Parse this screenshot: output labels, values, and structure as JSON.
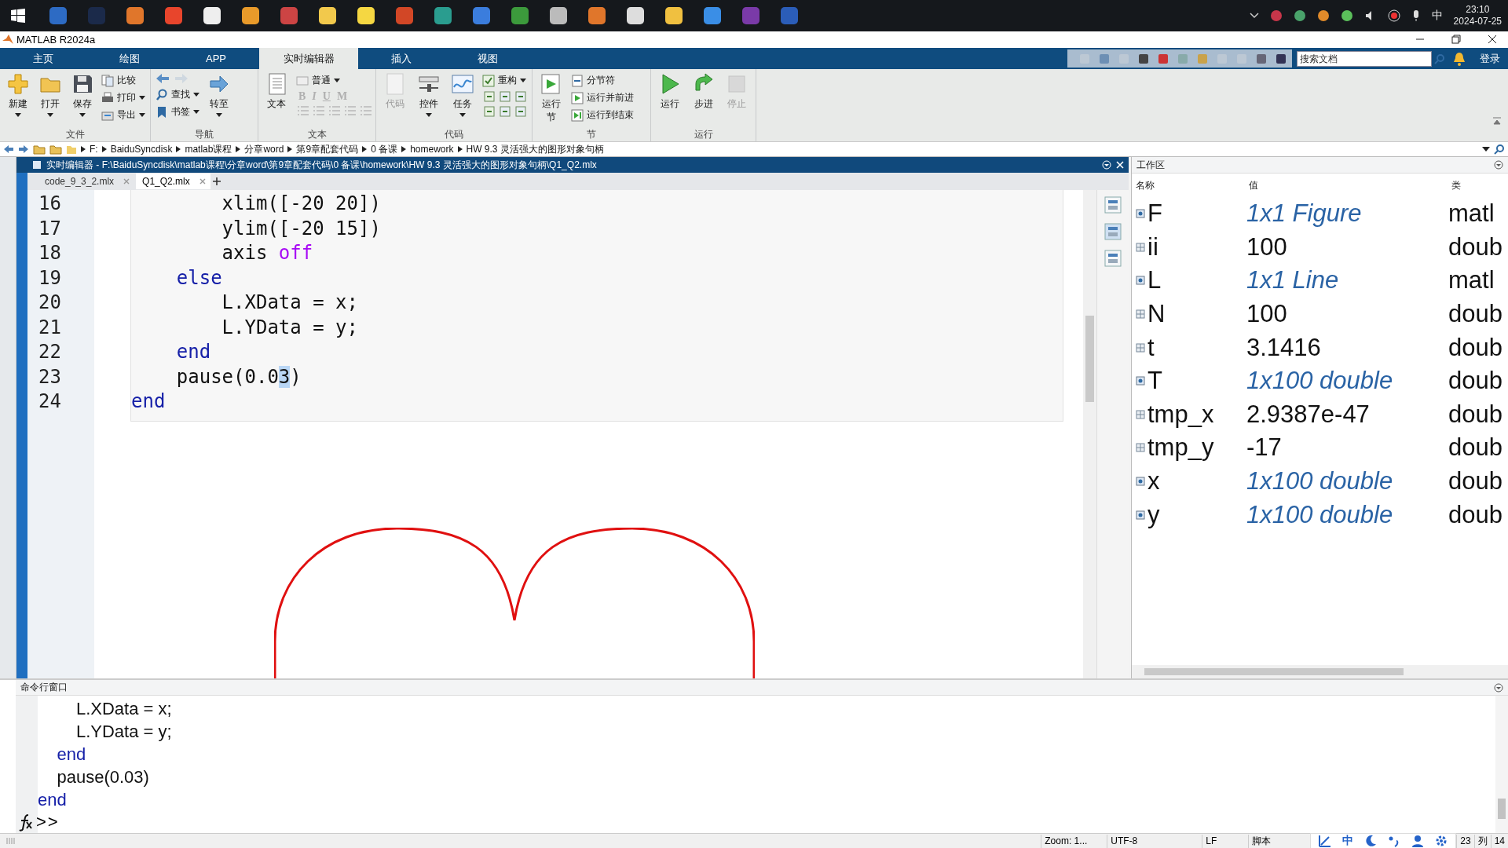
{
  "taskbar": {
    "time": "23:10",
    "date": "2024-07-25",
    "ime": "中"
  },
  "window": {
    "title": "MATLAB R2024a"
  },
  "ribbon_tabs": [
    {
      "label": "主页",
      "selected": false
    },
    {
      "label": "绘图",
      "selected": false
    },
    {
      "label": "APP",
      "selected": false
    },
    {
      "label": "实时编辑器",
      "selected": true
    },
    {
      "label": "插入",
      "selected": false
    },
    {
      "label": "视图",
      "selected": false
    }
  ],
  "search": {
    "placeholder": "搜索文档"
  },
  "sign_in": "登录",
  "ribbon": {
    "groups": [
      {
        "label": "文件",
        "large": [
          {
            "label": "新建",
            "dropdown": true,
            "disabled": false
          },
          {
            "label": "打开",
            "dropdown": true,
            "disabled": false
          },
          {
            "label": "保存",
            "dropdown": true,
            "disabled": false
          }
        ],
        "small": [
          {
            "label": "比较",
            "dropdown": false,
            "disabled": false
          },
          {
            "label": "打印",
            "dropdown": true,
            "disabled": false
          },
          {
            "label": "导出",
            "dropdown": true,
            "disabled": false
          }
        ]
      },
      {
        "label": "导航",
        "large": [
          {
            "label": "转至",
            "dropdown": true,
            "disabled": false
          }
        ],
        "small": [
          {
            "label": "查找",
            "dropdown": true,
            "disabled": false
          },
          {
            "label": "书签",
            "dropdown": true,
            "disabled": false
          }
        ]
      },
      {
        "label": "文本",
        "large": [
          {
            "label": "文本",
            "dropdown": false,
            "disabled": false
          }
        ],
        "small": [
          {
            "label": "普通",
            "dropdown": true,
            "disabled": false
          }
        ],
        "format": [
          {
            "label": "B",
            "disabled": true
          },
          {
            "label": "I",
            "disabled": true
          },
          {
            "label": "U",
            "disabled": true
          },
          {
            "label": "M",
            "disabled": true
          }
        ]
      },
      {
        "label": "代码",
        "large": [
          {
            "label": "代码",
            "dropdown": false,
            "disabled": true
          },
          {
            "label": "控件",
            "dropdown": true,
            "disabled": false
          },
          {
            "label": "任务",
            "dropdown": true,
            "disabled": false
          }
        ],
        "small": [
          {
            "label": "重构",
            "dropdown": true,
            "disabled": false
          }
        ]
      },
      {
        "label": "节",
        "large": [
          {
            "label": "运行节",
            "dropdown": false,
            "disabled": false
          }
        ],
        "small": [
          {
            "label": "分节符",
            "dropdown": false,
            "disabled": false
          },
          {
            "label": "运行并前进",
            "dropdown": false,
            "disabled": false
          },
          {
            "label": "运行到结束",
            "dropdown": false,
            "disabled": false
          }
        ]
      },
      {
        "label": "运行",
        "large": [
          {
            "label": "运行",
            "dropdown": false,
            "disabled": false
          },
          {
            "label": "步进",
            "dropdown": false,
            "disabled": false
          },
          {
            "label": "停止",
            "dropdown": false,
            "disabled": true
          }
        ]
      }
    ]
  },
  "address_path": [
    "F:",
    "BaiduSyncdisk",
    "matlab课程",
    "分章word",
    "第9章配套代码",
    "0 备课",
    "homework",
    "HW 9.3 灵活强大的图形对象句柄"
  ],
  "editor": {
    "title": "实时编辑器 - F:\\BaiduSyncdisk\\matlab课程\\分章word\\第9章配套代码\\0 备课\\homework\\HW 9.3 灵活强大的图形对象句柄\\Q1_Q2.mlx",
    "tabs": [
      {
        "label": "code_9_3_2.mlx",
        "selected": false
      },
      {
        "label": "Q1_Q2.mlx",
        "selected": true
      }
    ],
    "lines": [
      {
        "number": "16",
        "tokens": [
          {
            "text": "        xlim([-20 20])",
            "kind": "plain"
          }
        ]
      },
      {
        "number": "17",
        "tokens": [
          {
            "text": "        ylim([-20 15])",
            "kind": "plain"
          }
        ]
      },
      {
        "number": "18",
        "tokens": [
          {
            "text": "        axis ",
            "kind": "plain"
          },
          {
            "text": "off",
            "kind": "string"
          }
        ]
      },
      {
        "number": "19",
        "tokens": [
          {
            "text": "    else",
            "kind": "keyword"
          }
        ]
      },
      {
        "number": "20",
        "tokens": [
          {
            "text": "        L.XData = x;",
            "kind": "plain"
          }
        ]
      },
      {
        "number": "21",
        "tokens": [
          {
            "text": "        L.YData = y;",
            "kind": "plain"
          }
        ]
      },
      {
        "number": "22",
        "tokens": [
          {
            "text": "    end",
            "kind": "keyword"
          }
        ]
      },
      {
        "number": "23",
        "tokens": [
          {
            "text": "    pause(0.0",
            "kind": "plain"
          },
          {
            "text": "3",
            "kind": "selection"
          },
          {
            "text": ")",
            "kind": "plain"
          }
        ]
      },
      {
        "number": "24",
        "tokens": [
          {
            "text": "end",
            "kind": "keyword"
          }
        ]
      }
    ]
  },
  "workspace": {
    "title": "工作区",
    "columns": [
      "名称",
      "值",
      "类"
    ],
    "rows": [
      {
        "name": "F",
        "value": "1x1 Figure",
        "class": "matl",
        "kind": "object"
      },
      {
        "name": "ii",
        "value": "100",
        "class": "doub",
        "kind": "number"
      },
      {
        "name": "L",
        "value": "1x1 Line",
        "class": "matl",
        "kind": "object"
      },
      {
        "name": "N",
        "value": "100",
        "class": "doub",
        "kind": "number"
      },
      {
        "name": "t",
        "value": "3.1416",
        "class": "doub",
        "kind": "number"
      },
      {
        "name": "T",
        "value": "1x100 double",
        "class": "doub",
        "kind": "object"
      },
      {
        "name": "tmp_x",
        "value": "2.9387e-47",
        "class": "doub",
        "kind": "number"
      },
      {
        "name": "tmp_y",
        "value": "-17",
        "class": "doub",
        "kind": "number"
      },
      {
        "name": "x",
        "value": "1x100 double",
        "class": "doub",
        "kind": "object"
      },
      {
        "name": "y",
        "value": "1x100 double",
        "class": "doub",
        "kind": "object"
      }
    ]
  },
  "command_window": {
    "title": "命令行窗口",
    "lines": [
      {
        "text": "        L.XData = x;",
        "kind": "plain"
      },
      {
        "text": "        L.YData = y;",
        "kind": "plain"
      },
      {
        "text": "    end",
        "kind": "keyword"
      },
      {
        "text": "    pause(0.03)",
        "kind": "plain"
      },
      {
        "text": "end",
        "kind": "keyword"
      }
    ],
    "prompt": ">>"
  },
  "status_bar": {
    "items": [
      "Zoom: 1...",
      "UTF-8",
      "LF",
      "脚本"
    ],
    "ime_label": "中",
    "line": "23",
    "column_label": "列",
    "column": "14"
  }
}
